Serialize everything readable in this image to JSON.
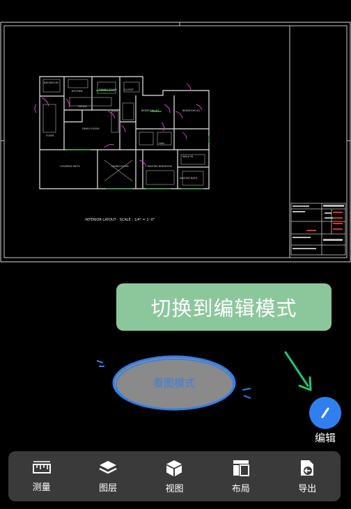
{
  "canvas": {
    "layout_title": "INTERIOR LAYOUT  -  SCALE : 1/4\" = 1'-0\"",
    "rooms": [
      "BATHROOM",
      "KITCHEN",
      "DINING ROOM",
      "CLOSET",
      "FAMILY ROOM",
      "BEDROOM #3",
      "BEDROOM #2",
      "FOYER",
      "COVERED PATIO",
      "LIVING ROOM",
      "MASTER BEDROOM",
      "MASTER BATH",
      "WALK IN CLOSET",
      "OFFICE",
      "HALL"
    ]
  },
  "banner": {
    "text": "切换到编辑模式"
  },
  "view_mode": {
    "label": "看图模式"
  },
  "edit": {
    "label": "编辑"
  },
  "toolbar": {
    "items": [
      {
        "id": "measure",
        "label": "测量",
        "icon": "ruler-icon"
      },
      {
        "id": "layers",
        "label": "图层",
        "icon": "layers-icon"
      },
      {
        "id": "view",
        "label": "视图",
        "icon": "cube-icon"
      },
      {
        "id": "layout",
        "label": "布局",
        "icon": "layout-icon"
      },
      {
        "id": "export",
        "label": "导出",
        "icon": "export-icon"
      }
    ]
  },
  "colors": {
    "banner_bg": "#8cc79c",
    "accent_blue": "#2f7ff0",
    "arrow_green": "#1ec878",
    "toolbar_bg": "#3a3a3a",
    "ellipse_fill": "#8a8a8a"
  }
}
